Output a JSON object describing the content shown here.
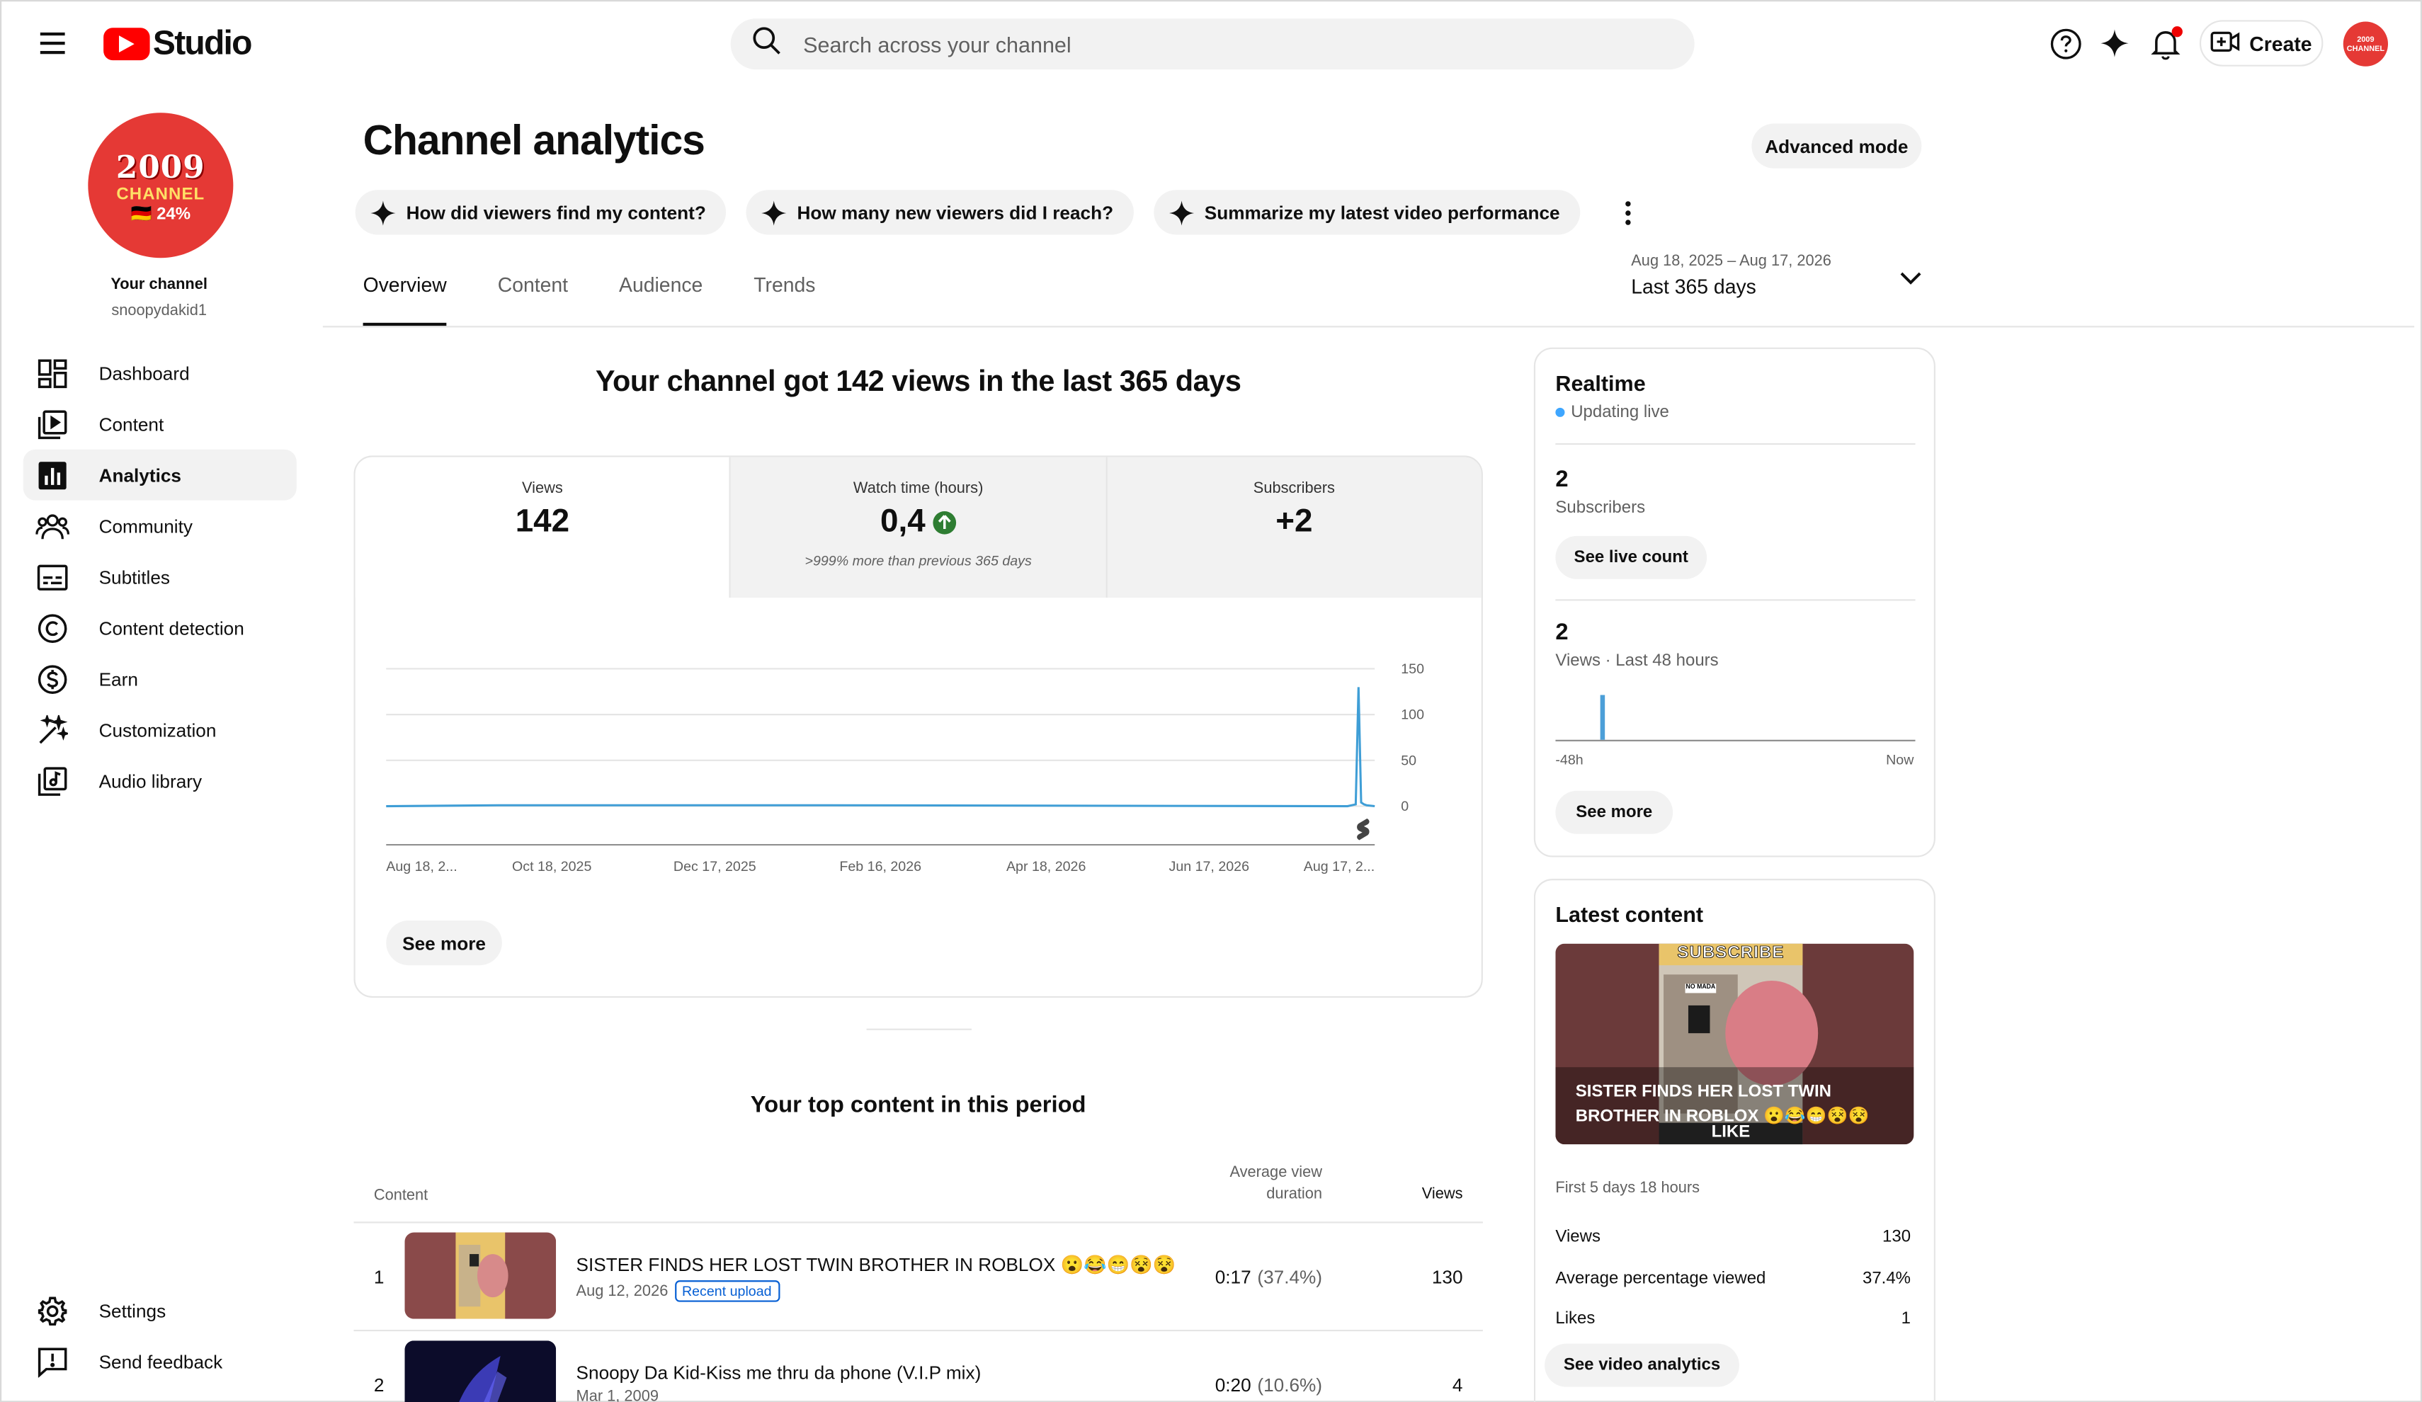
{
  "header": {
    "logo_text": "Studio",
    "search_placeholder": "Search across your channel",
    "create_label": "Create",
    "avatar_text": "2009 CHANNEL"
  },
  "sidebar": {
    "channel_badge": {
      "line1": "2009",
      "line2": "CHANNEL",
      "line3": "🇩🇪 24%"
    },
    "your_channel": "Your channel",
    "handle": "snoopydakid1",
    "items": [
      {
        "label": "Dashboard",
        "icon": "dashboard-icon"
      },
      {
        "label": "Content",
        "icon": "content-icon"
      },
      {
        "label": "Analytics",
        "icon": "analytics-icon",
        "active": true
      },
      {
        "label": "Community",
        "icon": "community-icon"
      },
      {
        "label": "Subtitles",
        "icon": "subtitles-icon"
      },
      {
        "label": "Content detection",
        "icon": "copyright-icon"
      },
      {
        "label": "Earn",
        "icon": "dollar-icon"
      },
      {
        "label": "Customization",
        "icon": "magic-wand-icon"
      },
      {
        "label": "Audio library",
        "icon": "audio-library-icon"
      }
    ],
    "bottom_items": [
      {
        "label": "Settings",
        "icon": "gear-icon"
      },
      {
        "label": "Send feedback",
        "icon": "feedback-icon"
      }
    ]
  },
  "page": {
    "title": "Channel analytics",
    "advanced_mode": "Advanced mode",
    "chips": [
      "How did viewers find my content?",
      "How many new viewers did I reach?",
      "Summarize my latest video performance"
    ],
    "tabs": [
      "Overview",
      "Content",
      "Audience",
      "Trends"
    ],
    "active_tab": "Overview",
    "date_range": {
      "dates": "Aug 18, 2025 – Aug 17, 2026",
      "label": "Last 365 days"
    }
  },
  "overview": {
    "headline": "Your channel got 142 views in the last 365 days",
    "metrics": [
      {
        "label": "Views",
        "value": "142",
        "note": ""
      },
      {
        "label": "Watch time (hours)",
        "value": "0,4",
        "note": ">999% more than previous 365 days",
        "trend": "up"
      },
      {
        "label": "Subscribers",
        "value": "+2",
        "note": ""
      }
    ],
    "see_more": "See more"
  },
  "chart_data": {
    "type": "line",
    "title": "",
    "xlabel": "",
    "ylabel": "",
    "x_ticks": [
      "Aug 18, 2...",
      "Oct 18, 2025",
      "Dec 17, 2025",
      "Feb 16, 2026",
      "Apr 18, 2026",
      "Jun 17, 2026",
      "Aug 17, 2..."
    ],
    "y_ticks": [
      "150",
      "100",
      "50",
      "0"
    ],
    "ylim": [
      0,
      150
    ],
    "series": [
      {
        "name": "",
        "color": "#3f9ed6",
        "x": [
          "2025-08-18",
          "2025-09-28",
          "2025-10-30",
          "2026-01-29",
          "2026-08-07",
          "2026-08-10",
          "2026-08-11",
          "2026-08-12",
          "2026-08-13",
          "2026-08-14",
          "2026-08-17"
        ],
        "y": [
          0,
          1,
          1,
          1,
          0,
          2,
          130,
          4,
          2,
          1,
          0
        ]
      }
    ],
    "grid": true
  },
  "top_content": {
    "title": "Your top content in this period",
    "headers": {
      "content": "Content",
      "avd_line1": "Average view",
      "avd_line2": "duration",
      "views": "Views"
    },
    "rows": [
      {
        "rank": "1",
        "title": "SISTER FINDS HER LOST TWIN BROTHER IN ROBLOX 😮😂😁😵😵",
        "date": "Aug 12, 2026",
        "badge": "Recent upload",
        "duration": "0:17",
        "pct": "(37.4%)",
        "views": "130"
      },
      {
        "rank": "2",
        "title": "Snoopy Da Kid-Kiss me thru da phone (V.I.P mix)",
        "date": "Mar 1, 2009",
        "badge": "",
        "duration": "0:20",
        "pct": "(10.6%)",
        "views": "4"
      }
    ]
  },
  "realtime": {
    "title": "Realtime",
    "live": "Updating live",
    "subs_value": "2",
    "subs_label": "Subscribers",
    "see_live": "See live count",
    "views_value": "2",
    "views_label": "Views · Last 48 hours",
    "axis_start": "-48h",
    "axis_end": "Now",
    "see_more": "See more"
  },
  "latest": {
    "title": "Latest content",
    "thumb_caption": "SISTER FINDS HER LOST TWIN BROTHER IN ROBLOX 😮😂😁😵😵",
    "thumb_top_text": "SUBSCRIBE",
    "thumb_bottom_text": "LIKE",
    "thumb_tag": "NO MADA",
    "period": "First 5 days 18 hours",
    "stats": [
      {
        "label": "Views",
        "value": "130"
      },
      {
        "label": "Average percentage viewed",
        "value": "37.4%"
      },
      {
        "label": "Likes",
        "value": "1"
      }
    ],
    "button": "See video analytics"
  }
}
